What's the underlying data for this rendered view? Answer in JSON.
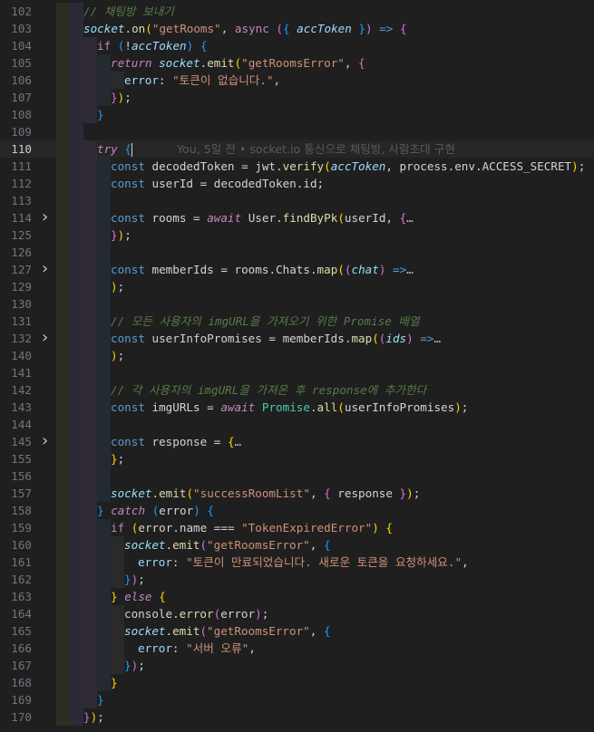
{
  "editor": {
    "blame_annotation": "You, 5일 전 • socket.io 통신으로 채팅방, 사람초대 구현",
    "active_line": 110,
    "folded_lines": [
      114,
      127,
      132,
      145
    ],
    "lines": [
      {
        "n": 102,
        "indent": 1,
        "tokens": [
          [
            "t-comment",
            "// 채팅방 보내기"
          ]
        ]
      },
      {
        "n": 103,
        "indent": 1,
        "tokens": [
          [
            "t-vari",
            "socket"
          ],
          [
            "t-op",
            "."
          ],
          [
            "t-fn",
            "on"
          ],
          [
            "t-br1",
            "("
          ],
          [
            "t-str",
            "\"getRooms\""
          ],
          [
            "t-op",
            ", "
          ],
          [
            "t-kw",
            "async"
          ],
          [
            "t-op",
            " "
          ],
          [
            "t-br2",
            "("
          ],
          [
            "t-br3",
            "{"
          ],
          [
            "t-op",
            " "
          ],
          [
            "t-vari",
            "accToken"
          ],
          [
            "t-op",
            " "
          ],
          [
            "t-br3",
            "}"
          ],
          [
            "t-br2",
            ")"
          ],
          [
            "t-op",
            " "
          ],
          [
            "t-type",
            "=>"
          ],
          [
            "t-op",
            " "
          ],
          [
            "t-br2",
            "{"
          ]
        ]
      },
      {
        "n": 104,
        "indent": 2,
        "tokens": [
          [
            "t-kw",
            "if"
          ],
          [
            "t-op",
            " "
          ],
          [
            "t-br3",
            "("
          ],
          [
            "t-op",
            "!"
          ],
          [
            "t-vari",
            "accToken"
          ],
          [
            "t-br3",
            ")"
          ],
          [
            "t-op",
            " "
          ],
          [
            "t-br3",
            "{"
          ]
        ]
      },
      {
        "n": 105,
        "indent": 3,
        "tokens": [
          [
            "t-kwi",
            "return"
          ],
          [
            "t-op",
            " "
          ],
          [
            "t-vari",
            "socket"
          ],
          [
            "t-op",
            "."
          ],
          [
            "t-fn",
            "emit"
          ],
          [
            "t-br1",
            "("
          ],
          [
            "t-str",
            "\"getRoomsError\""
          ],
          [
            "t-op",
            ", "
          ],
          [
            "t-br2",
            "{"
          ]
        ]
      },
      {
        "n": 106,
        "indent": 4,
        "tokens": [
          [
            "t-prop",
            "error"
          ],
          [
            "t-op",
            ": "
          ],
          [
            "t-str",
            "\"토큰이 없습니다.\""
          ],
          [
            "t-op",
            ","
          ]
        ]
      },
      {
        "n": 107,
        "indent": 3,
        "tokens": [
          [
            "t-br2",
            "}"
          ],
          [
            "t-br1",
            ")"
          ],
          [
            "t-op",
            ";"
          ]
        ]
      },
      {
        "n": 108,
        "indent": 2,
        "tokens": [
          [
            "t-br3",
            "}"
          ]
        ]
      },
      {
        "n": 109,
        "indent": 0,
        "tokens": []
      },
      {
        "n": 110,
        "indent": 2,
        "tokens": [
          [
            "t-kwi",
            "try"
          ],
          [
            "t-op",
            " "
          ],
          [
            "t-br3",
            "{"
          ]
        ],
        "cursor": true,
        "blame": true
      },
      {
        "n": 111,
        "indent": 3,
        "tokens": [
          [
            "t-type",
            "const"
          ],
          [
            "t-op",
            " "
          ],
          [
            "t-op",
            "decodedToken"
          ],
          [
            "t-op",
            " = "
          ],
          [
            "t-op",
            "jwt"
          ],
          [
            "t-op",
            "."
          ],
          [
            "t-fn",
            "verify"
          ],
          [
            "t-br1",
            "("
          ],
          [
            "t-vari",
            "accToken"
          ],
          [
            "t-op",
            ", "
          ],
          [
            "t-op",
            "process"
          ],
          [
            "t-op",
            "."
          ],
          [
            "t-op",
            "env"
          ],
          [
            "t-op",
            "."
          ],
          [
            "t-op",
            "ACCESS_SECRET"
          ],
          [
            "t-br1",
            ")"
          ],
          [
            "t-op",
            ";"
          ]
        ]
      },
      {
        "n": 112,
        "indent": 3,
        "tokens": [
          [
            "t-type",
            "const"
          ],
          [
            "t-op",
            " "
          ],
          [
            "t-op",
            "userId"
          ],
          [
            "t-op",
            " = "
          ],
          [
            "t-op",
            "decodedToken"
          ],
          [
            "t-op",
            "."
          ],
          [
            "t-op",
            "id"
          ],
          [
            "t-op",
            ";"
          ]
        ]
      },
      {
        "n": 113,
        "indent": 3,
        "tokens": []
      },
      {
        "n": 114,
        "indent": 3,
        "tokens": [
          [
            "t-type",
            "const"
          ],
          [
            "t-op",
            " "
          ],
          [
            "t-op",
            "rooms"
          ],
          [
            "t-op",
            " = "
          ],
          [
            "t-kwi",
            "await"
          ],
          [
            "t-op",
            " "
          ],
          [
            "t-op",
            "User"
          ],
          [
            "t-op",
            "."
          ],
          [
            "t-fn",
            "findByPk"
          ],
          [
            "t-br1",
            "("
          ],
          [
            "t-op",
            "userId"
          ],
          [
            "t-op",
            ", "
          ],
          [
            "t-br2",
            "{"
          ],
          [
            "t-dots",
            "…"
          ]
        ]
      },
      {
        "n": 125,
        "indent": 3,
        "tokens": [
          [
            "t-br2",
            "}"
          ],
          [
            "t-br1",
            ")"
          ],
          [
            "t-op",
            ";"
          ]
        ]
      },
      {
        "n": 126,
        "indent": 3,
        "tokens": []
      },
      {
        "n": 127,
        "indent": 3,
        "tokens": [
          [
            "t-type",
            "const"
          ],
          [
            "t-op",
            " "
          ],
          [
            "t-op",
            "memberIds"
          ],
          [
            "t-op",
            " = "
          ],
          [
            "t-op",
            "rooms"
          ],
          [
            "t-op",
            "."
          ],
          [
            "t-op",
            "Chats"
          ],
          [
            "t-op",
            "."
          ],
          [
            "t-fn",
            "map"
          ],
          [
            "t-br1",
            "("
          ],
          [
            "t-br2",
            "("
          ],
          [
            "t-vari",
            "chat"
          ],
          [
            "t-br2",
            ")"
          ],
          [
            "t-op",
            " "
          ],
          [
            "t-type",
            "=>"
          ],
          [
            "t-dots",
            "…"
          ]
        ]
      },
      {
        "n": 129,
        "indent": 3,
        "tokens": [
          [
            "t-br1",
            ")"
          ],
          [
            "t-op",
            ";"
          ]
        ]
      },
      {
        "n": 130,
        "indent": 3,
        "tokens": []
      },
      {
        "n": 131,
        "indent": 3,
        "tokens": [
          [
            "t-comment",
            "// 모든 사용자의 imgURL을 가져오기 위한 Promise 배열"
          ]
        ]
      },
      {
        "n": 132,
        "indent": 3,
        "tokens": [
          [
            "t-type",
            "const"
          ],
          [
            "t-op",
            " "
          ],
          [
            "t-op",
            "userInfoPromises"
          ],
          [
            "t-op",
            " = "
          ],
          [
            "t-op",
            "memberIds"
          ],
          [
            "t-op",
            "."
          ],
          [
            "t-fn",
            "map"
          ],
          [
            "t-br1",
            "("
          ],
          [
            "t-br2",
            "("
          ],
          [
            "t-vari",
            "ids"
          ],
          [
            "t-br2",
            ")"
          ],
          [
            "t-op",
            " "
          ],
          [
            "t-type",
            "=>"
          ],
          [
            "t-dots",
            "…"
          ]
        ]
      },
      {
        "n": 140,
        "indent": 3,
        "tokens": [
          [
            "t-br1",
            ")"
          ],
          [
            "t-op",
            ";"
          ]
        ]
      },
      {
        "n": 141,
        "indent": 3,
        "tokens": []
      },
      {
        "n": 142,
        "indent": 3,
        "tokens": [
          [
            "t-comment",
            "// 각 사용자의 imgURL을 가져온 후 response에 추가한다"
          ]
        ]
      },
      {
        "n": 143,
        "indent": 3,
        "tokens": [
          [
            "t-type",
            "const"
          ],
          [
            "t-op",
            " "
          ],
          [
            "t-op",
            "imgURLs"
          ],
          [
            "t-op",
            " = "
          ],
          [
            "t-kwi",
            "await"
          ],
          [
            "t-op",
            " "
          ],
          [
            "t-class",
            "Promise"
          ],
          [
            "t-op",
            "."
          ],
          [
            "t-fn",
            "all"
          ],
          [
            "t-br1",
            "("
          ],
          [
            "t-op",
            "userInfoPromises"
          ],
          [
            "t-br1",
            ")"
          ],
          [
            "t-op",
            ";"
          ]
        ]
      },
      {
        "n": 144,
        "indent": 3,
        "tokens": []
      },
      {
        "n": 145,
        "indent": 3,
        "tokens": [
          [
            "t-type",
            "const"
          ],
          [
            "t-op",
            " "
          ],
          [
            "t-op",
            "response"
          ],
          [
            "t-op",
            " = "
          ],
          [
            "t-br1",
            "{"
          ],
          [
            "t-dots",
            "…"
          ]
        ]
      },
      {
        "n": 155,
        "indent": 3,
        "tokens": [
          [
            "t-br1",
            "}"
          ],
          [
            "t-op",
            ";"
          ]
        ]
      },
      {
        "n": 156,
        "indent": 3,
        "tokens": []
      },
      {
        "n": 157,
        "indent": 3,
        "tokens": [
          [
            "t-vari",
            "socket"
          ],
          [
            "t-op",
            "."
          ],
          [
            "t-fn",
            "emit"
          ],
          [
            "t-br1",
            "("
          ],
          [
            "t-str",
            "\"successRoomList\""
          ],
          [
            "t-op",
            ", "
          ],
          [
            "t-br2",
            "{"
          ],
          [
            "t-op",
            " response "
          ],
          [
            "t-br2",
            "}"
          ],
          [
            "t-br1",
            ")"
          ],
          [
            "t-op",
            ";"
          ]
        ]
      },
      {
        "n": 158,
        "indent": 2,
        "tokens": [
          [
            "t-br3",
            "}"
          ],
          [
            "t-op",
            " "
          ],
          [
            "t-kwi",
            "catch"
          ],
          [
            "t-op",
            " "
          ],
          [
            "t-br3",
            "("
          ],
          [
            "t-op",
            "error"
          ],
          [
            "t-br3",
            ")"
          ],
          [
            "t-op",
            " "
          ],
          [
            "t-br3",
            "{"
          ]
        ]
      },
      {
        "n": 159,
        "indent": 3,
        "tokens": [
          [
            "t-kw",
            "if"
          ],
          [
            "t-op",
            " "
          ],
          [
            "t-br1",
            "("
          ],
          [
            "t-op",
            "error"
          ],
          [
            "t-op",
            "."
          ],
          [
            "t-op",
            "name"
          ],
          [
            "t-op",
            " === "
          ],
          [
            "t-str",
            "\"TokenExpiredError\""
          ],
          [
            "t-br1",
            ")"
          ],
          [
            "t-op",
            " "
          ],
          [
            "t-br1",
            "{"
          ]
        ]
      },
      {
        "n": 160,
        "indent": 4,
        "tokens": [
          [
            "t-vari",
            "socket"
          ],
          [
            "t-op",
            "."
          ],
          [
            "t-fn",
            "emit"
          ],
          [
            "t-br2",
            "("
          ],
          [
            "t-str",
            "\"getRoomsError\""
          ],
          [
            "t-op",
            ", "
          ],
          [
            "t-br3",
            "{"
          ]
        ]
      },
      {
        "n": 161,
        "indent": 5,
        "tokens": [
          [
            "t-prop",
            "error"
          ],
          [
            "t-op",
            ": "
          ],
          [
            "t-str",
            "\"토큰이 만료되었습니다. 새로운 토큰을 요청하세요.\""
          ],
          [
            "t-op",
            ","
          ]
        ]
      },
      {
        "n": 162,
        "indent": 4,
        "tokens": [
          [
            "t-br3",
            "}"
          ],
          [
            "t-br2",
            ")"
          ],
          [
            "t-op",
            ";"
          ]
        ]
      },
      {
        "n": 163,
        "indent": 3,
        "tokens": [
          [
            "t-br1",
            "}"
          ],
          [
            "t-op",
            " "
          ],
          [
            "t-kwi",
            "else"
          ],
          [
            "t-op",
            " "
          ],
          [
            "t-br1",
            "{"
          ]
        ]
      },
      {
        "n": 164,
        "indent": 4,
        "tokens": [
          [
            "t-op",
            "console"
          ],
          [
            "t-op",
            "."
          ],
          [
            "t-fn",
            "error"
          ],
          [
            "t-br2",
            "("
          ],
          [
            "t-op",
            "error"
          ],
          [
            "t-br2",
            ")"
          ],
          [
            "t-op",
            ";"
          ]
        ]
      },
      {
        "n": 165,
        "indent": 4,
        "tokens": [
          [
            "t-vari",
            "socket"
          ],
          [
            "t-op",
            "."
          ],
          [
            "t-fn",
            "emit"
          ],
          [
            "t-br2",
            "("
          ],
          [
            "t-str",
            "\"getRoomsError\""
          ],
          [
            "t-op",
            ", "
          ],
          [
            "t-br3",
            "{"
          ]
        ]
      },
      {
        "n": 166,
        "indent": 5,
        "tokens": [
          [
            "t-prop",
            "error"
          ],
          [
            "t-op",
            ": "
          ],
          [
            "t-str",
            "\"서버 오류\""
          ],
          [
            "t-op",
            ","
          ]
        ]
      },
      {
        "n": 167,
        "indent": 4,
        "tokens": [
          [
            "t-br3",
            "}"
          ],
          [
            "t-br2",
            ")"
          ],
          [
            "t-op",
            ";"
          ]
        ]
      },
      {
        "n": 168,
        "indent": 3,
        "tokens": [
          [
            "t-br1",
            "}"
          ]
        ]
      },
      {
        "n": 169,
        "indent": 2,
        "tokens": [
          [
            "t-br3",
            "}"
          ]
        ]
      },
      {
        "n": 170,
        "indent": 1,
        "tokens": [
          [
            "t-br2",
            "}"
          ],
          [
            "t-br1",
            ")"
          ],
          [
            "t-op",
            ";"
          ]
        ]
      }
    ]
  }
}
